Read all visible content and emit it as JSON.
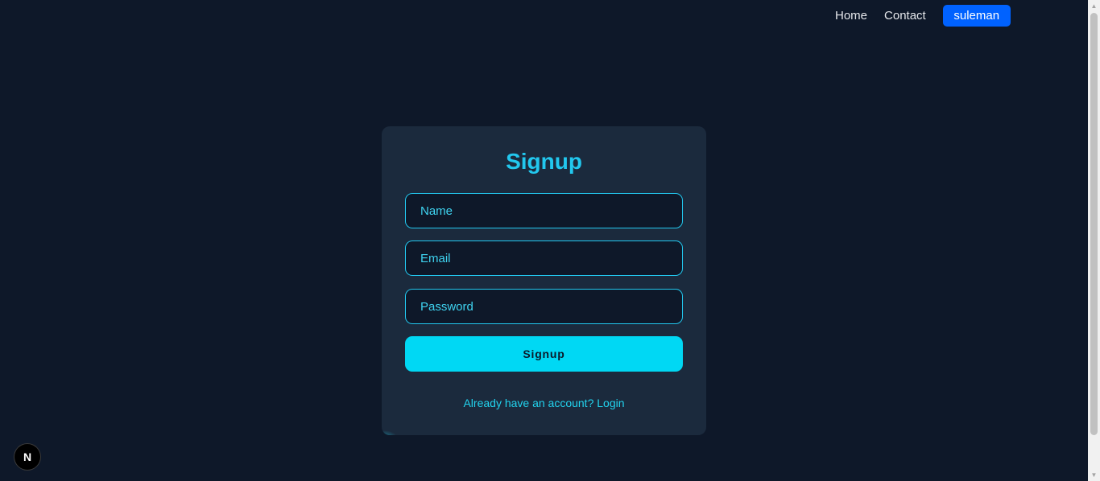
{
  "nav": {
    "home_label": "Home",
    "contact_label": "Contact",
    "user_label": "suleman"
  },
  "form": {
    "title": "Signup",
    "name_placeholder": "Name",
    "email_placeholder": "Email",
    "password_placeholder": "Password",
    "submit_label": "Signup",
    "login_prompt": "Already have an account? Login"
  },
  "badge": {
    "letter": "N",
    "icon": "nextjs-icon"
  },
  "colors": {
    "background": "#0e1829",
    "card": "#1b2a3d",
    "accent": "#00d8f4",
    "user_button": "#0062ff"
  }
}
